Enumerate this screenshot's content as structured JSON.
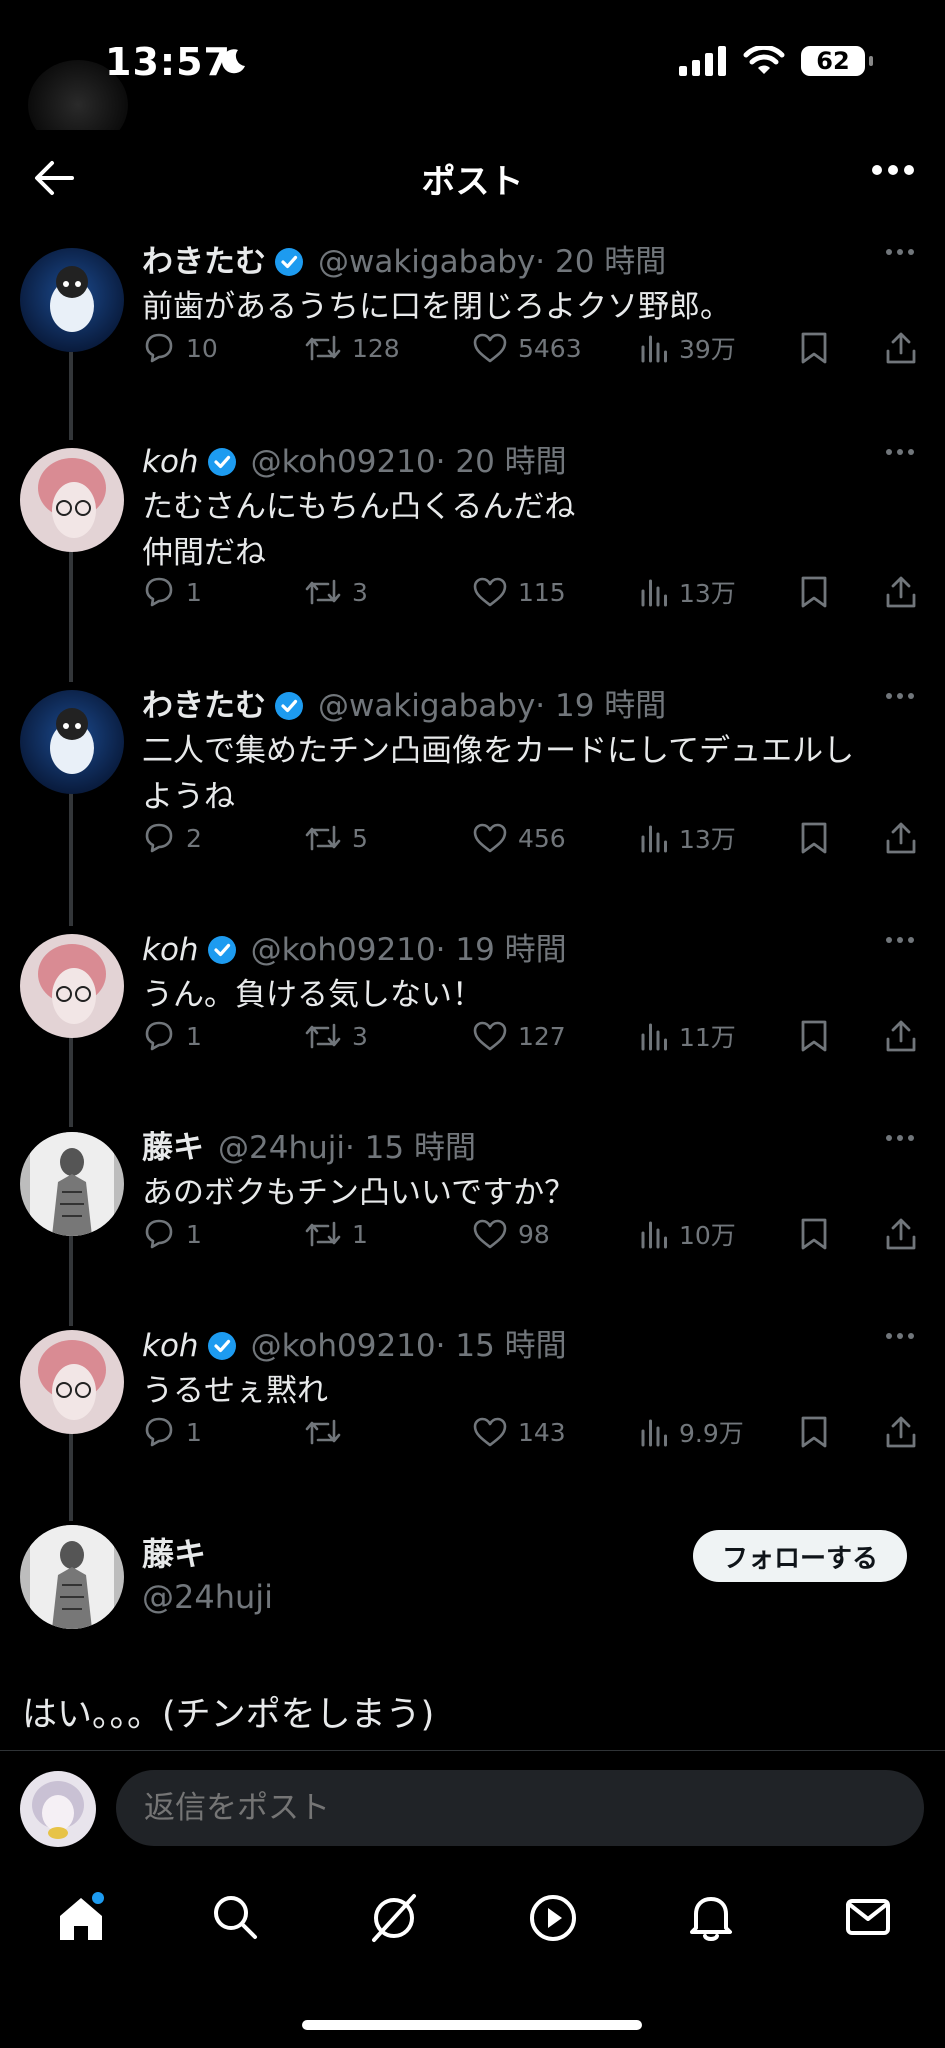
{
  "status": {
    "time": "13:57",
    "battery": "62"
  },
  "nav": {
    "title": "ポスト"
  },
  "tweets": [
    {
      "name": "わきたむ",
      "italic": false,
      "verified": true,
      "handle": "@wakigababy",
      "time": "· 20 時間",
      "text": "前歯があるうちに口を閉じろよクソ野郎。",
      "replies": "10",
      "retweets": "128",
      "likes": "5463",
      "views": "39万"
    },
    {
      "name": "koh",
      "italic": true,
      "verified": true,
      "handle": "@koh09210",
      "time": "· 20 時間",
      "text": "たむさんにもちん凸くるんだね\n仲間だね",
      "replies": "1",
      "retweets": "3",
      "likes": "115",
      "views": "13万"
    },
    {
      "name": "わきたむ",
      "italic": false,
      "verified": true,
      "handle": "@wakigababy",
      "time": "· 19 時間",
      "text": "二人で集めたチン凸画像をカードにしてデュエルし\nようね",
      "replies": "2",
      "retweets": "5",
      "likes": "456",
      "views": "13万"
    },
    {
      "name": "koh",
      "italic": true,
      "verified": true,
      "handle": "@koh09210",
      "time": "· 19 時間",
      "text": "うん。負ける気しない！",
      "replies": "1",
      "retweets": "3",
      "likes": "127",
      "views": "11万"
    },
    {
      "name": "藤キ",
      "italic": false,
      "verified": false,
      "handle": "@24huji",
      "time": "· 15 時間",
      "text": "あのボクもチン凸いいですか？",
      "replies": "1",
      "retweets": "1",
      "likes": "98",
      "views": "10万"
    },
    {
      "name": "koh",
      "italic": true,
      "verified": true,
      "handle": "@koh09210",
      "time": "· 15 時間",
      "text": "うるせぇ黙れ",
      "replies": "1",
      "retweets": "",
      "likes": "143",
      "views": "9.9万"
    }
  ],
  "main_post": {
    "name": "藤キ",
    "handle": "@24huji",
    "follow_label": "フォローする",
    "text": "はい。。。(チンポをしまう)"
  },
  "reply": {
    "placeholder": "返信をポスト"
  },
  "colors": {
    "verified": "#1d9bf0",
    "accent_dot": "#1d9bf0"
  }
}
